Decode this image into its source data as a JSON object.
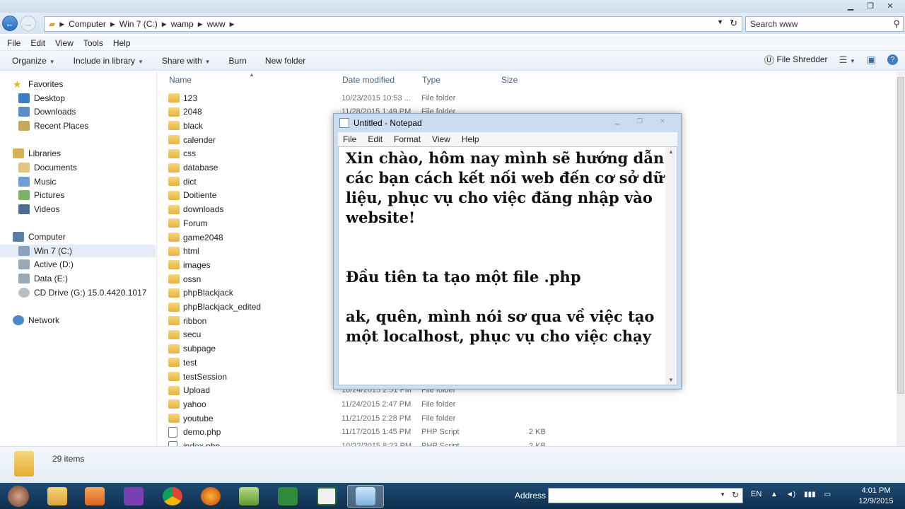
{
  "address": {
    "crumbs": [
      "Computer",
      "Win 7 (C:)",
      "wamp",
      "www"
    ],
    "search_placeholder": "Search www"
  },
  "menu": [
    "File",
    "Edit",
    "View",
    "Tools",
    "Help"
  ],
  "toolbar": {
    "organize": "Organize",
    "include": "Include in library",
    "share": "Share with",
    "burn": "Burn",
    "new_folder": "New folder",
    "shredder": "File Shredder"
  },
  "nav": {
    "favorites": "Favorites",
    "desktop": "Desktop",
    "downloads": "Downloads",
    "recent": "Recent Places",
    "libraries": "Libraries",
    "documents": "Documents",
    "music": "Music",
    "pictures": "Pictures",
    "videos": "Videos",
    "computer": "Computer",
    "win7": "Win 7 (C:)",
    "active": "Active (D:)",
    "data": "Data (E:)",
    "cd": "CD Drive (G:) 15.0.4420.1017",
    "network": "Network"
  },
  "columns": {
    "name": "Name",
    "date": "Date modified",
    "type": "Type",
    "size": "Size"
  },
  "files": [
    {
      "name": "123",
      "date": "10/23/2015 10:53 ...",
      "type": "File folder",
      "size": ""
    },
    {
      "name": "2048",
      "date": "11/28/2015 1:49 PM",
      "type": "File folder",
      "size": ""
    },
    {
      "name": "black",
      "date": "",
      "type": "",
      "size": ""
    },
    {
      "name": "calender",
      "date": "",
      "type": "",
      "size": ""
    },
    {
      "name": "css",
      "date": "",
      "type": "",
      "size": ""
    },
    {
      "name": "database",
      "date": "",
      "type": "",
      "size": ""
    },
    {
      "name": "dict",
      "date": "",
      "type": "",
      "size": ""
    },
    {
      "name": "Doitiente",
      "date": "",
      "type": "",
      "size": ""
    },
    {
      "name": "downloads",
      "date": "",
      "type": "",
      "size": ""
    },
    {
      "name": "Forum",
      "date": "",
      "type": "",
      "size": ""
    },
    {
      "name": "game2048",
      "date": "",
      "type": "",
      "size": ""
    },
    {
      "name": "html",
      "date": "",
      "type": "",
      "size": ""
    },
    {
      "name": "images",
      "date": "",
      "type": "",
      "size": ""
    },
    {
      "name": "ossn",
      "date": "",
      "type": "",
      "size": ""
    },
    {
      "name": "phpBlackjack",
      "date": "",
      "type": "",
      "size": ""
    },
    {
      "name": "phpBlackjack_edited",
      "date": "",
      "type": "",
      "size": ""
    },
    {
      "name": "ribbon",
      "date": "",
      "type": "",
      "size": ""
    },
    {
      "name": "secu",
      "date": "",
      "type": "",
      "size": ""
    },
    {
      "name": "subpage",
      "date": "",
      "type": "",
      "size": ""
    },
    {
      "name": "test",
      "date": "",
      "type": "",
      "size": ""
    },
    {
      "name": "testSession",
      "date": "",
      "type": "",
      "size": ""
    },
    {
      "name": "Upload",
      "date": "10/24/2015 2:51 PM",
      "type": "File folder",
      "size": ""
    },
    {
      "name": "yahoo",
      "date": "11/24/2015 2:47 PM",
      "type": "File folder",
      "size": ""
    },
    {
      "name": "youtube",
      "date": "11/21/2015 2:28 PM",
      "type": "File folder",
      "size": ""
    },
    {
      "name": "demo.php",
      "date": "11/17/2015 1:45 PM",
      "type": "PHP Script",
      "size": "2 KB"
    },
    {
      "name": "index.php",
      "date": "10/22/2015 8:23 PM",
      "type": "PHP Script",
      "size": "2 KB"
    }
  ],
  "status": {
    "count": "29 items"
  },
  "notepad": {
    "title": "Untitled - Notepad",
    "menu": [
      "File",
      "Edit",
      "Format",
      "View",
      "Help"
    ],
    "text": "Xin chào, hôm nay mình sẽ hướng dẫn các bạn cách kết nối web đến cơ sở dữ liệu, phục vụ cho việc đăng nhập vào website!\n\n\nĐầu tiên ta tạo một file .php\n\nak, quên, mình nói sơ qua về việc tạo một localhost, phục vụ cho việc chạy"
  },
  "taskbar": {
    "address_label": "Address",
    "lang": "EN",
    "time": "4:01 PM",
    "date": "12/9/2015"
  }
}
